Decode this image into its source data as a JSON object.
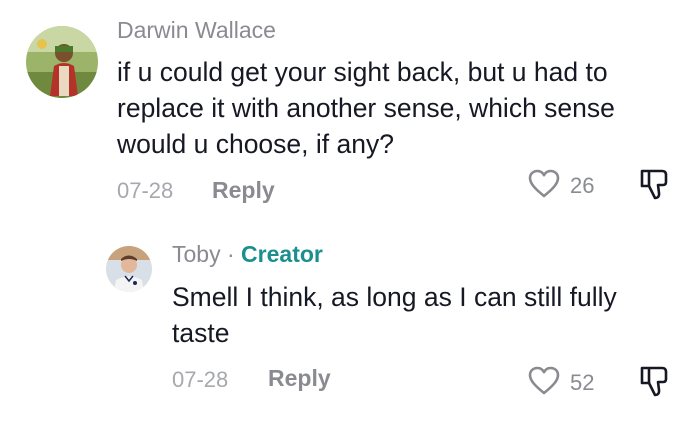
{
  "comments": [
    {
      "username": "Darwin Wallace",
      "text": "if u could get your sight back, but u had to replace it with another sense, which sense would u choose, if any?",
      "date": "07-28",
      "reply_label": "Reply",
      "likes": "26"
    }
  ],
  "replies": [
    {
      "username": "Toby",
      "separator": " · ",
      "badge": "Creator",
      "text": "Smell I think, as long as I can still fully taste",
      "date": "07-28",
      "reply_label": "Reply",
      "likes": "52"
    }
  ],
  "colors": {
    "text": "#161823",
    "muted": "#8a8b91",
    "date": "#a7a8ad",
    "creator_badge": "#1a8f8d"
  },
  "icons": [
    "heart-icon",
    "dislike-icon"
  ]
}
